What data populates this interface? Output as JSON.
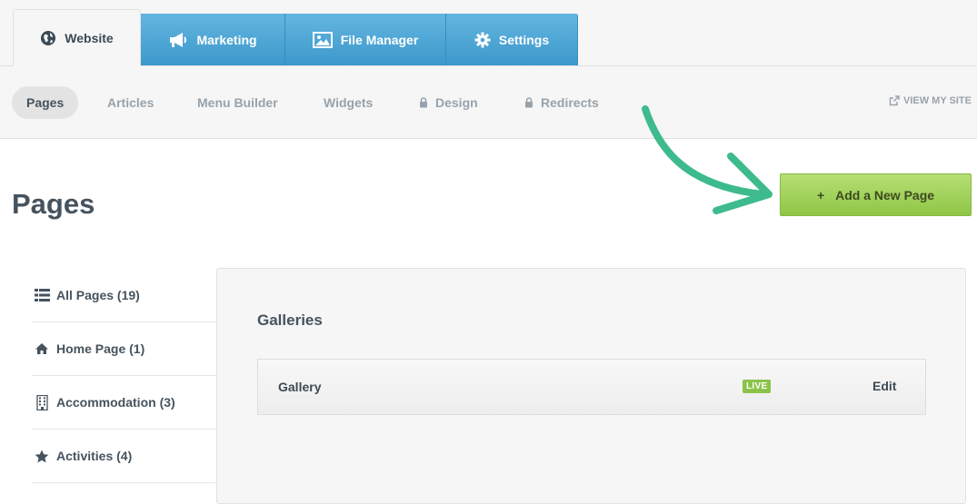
{
  "main_tabs": [
    {
      "label": "Website",
      "icon": "globe-icon"
    },
    {
      "label": "Marketing",
      "icon": "megaphone-icon"
    },
    {
      "label": "File Manager",
      "icon": "image-icon"
    },
    {
      "label": "Settings",
      "icon": "gear-icon"
    }
  ],
  "sub_tabs": [
    {
      "label": "Pages"
    },
    {
      "label": "Articles"
    },
    {
      "label": "Menu Builder"
    },
    {
      "label": "Widgets"
    },
    {
      "label": "Design",
      "locked": true
    },
    {
      "label": "Redirects",
      "locked": true
    }
  ],
  "view_site": "VIEW MY SITE",
  "page_title": "Pages",
  "add_button": {
    "plus": "+",
    "label": "Add a New Page"
  },
  "sidebar": [
    {
      "label": "All Pages (19)",
      "icon": "list-icon"
    },
    {
      "label": "Home Page (1)",
      "icon": "home-icon"
    },
    {
      "label": "Accommodation (3)",
      "icon": "building-icon"
    },
    {
      "label": "Activities (4)",
      "icon": "star-icon"
    }
  ],
  "panel": {
    "title": "Galleries",
    "row": {
      "name": "Gallery",
      "status": "LIVE",
      "action": "Edit"
    }
  },
  "colors": {
    "tab_blue": "#4aa6d6",
    "accent_green": "#8fc647",
    "live_badge": "#8bc34a",
    "arrow_teal": "#3dbb8c"
  }
}
